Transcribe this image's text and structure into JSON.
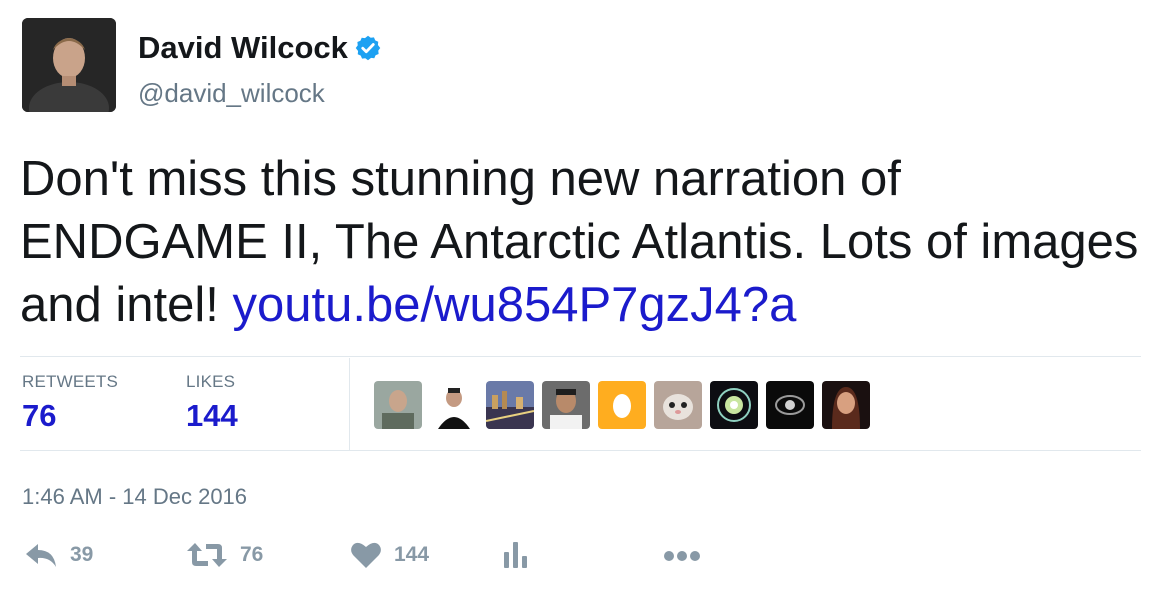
{
  "author": {
    "name": "David Wilcock",
    "handle": "@david_wilcock",
    "verified": true
  },
  "tweet": {
    "text": "Don't miss this stunning new narration of ENDGAME II, The Antarctic Atlantis. Lots of images and intel! ",
    "link": "youtu.be/wu854P7gzJ4?a"
  },
  "stats": {
    "retweets_label": "RETWEETS",
    "retweets_value": "76",
    "likes_label": "LIKES",
    "likes_value": "144"
  },
  "likers": [
    "liker-avatar",
    "liker-avatar",
    "liker-avatar",
    "liker-avatar",
    "default-egg-avatar",
    "liker-avatar",
    "liker-avatar",
    "liker-avatar",
    "liker-avatar"
  ],
  "timestamp": "1:46 AM - 14 Dec 2016",
  "actions": {
    "reply_count": "39",
    "retweet_count": "76",
    "like_count": "144"
  },
  "colors": {
    "link": "#1b1bcc",
    "verified": "#1da1f2",
    "muted": "#657786",
    "icon": "#8899a6",
    "egg_bg": "#ffad1f"
  }
}
